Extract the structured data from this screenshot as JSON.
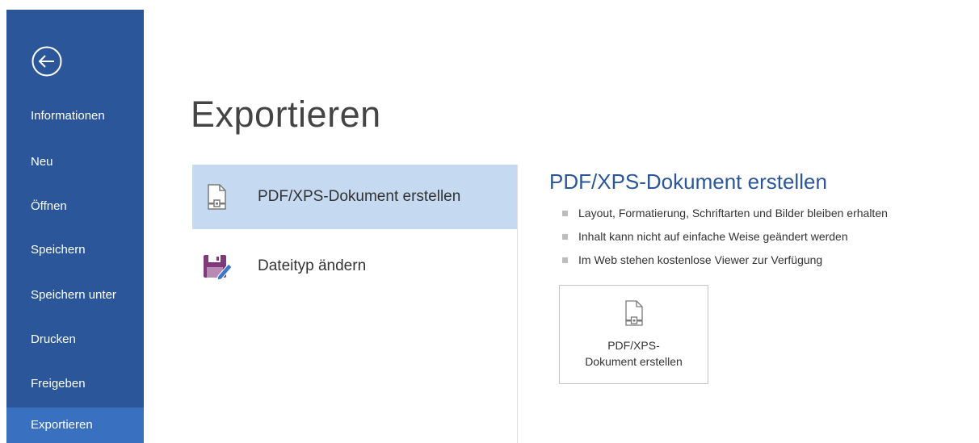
{
  "sidebar": {
    "items": [
      {
        "label": "Informationen"
      },
      {
        "label": "Neu"
      },
      {
        "label": "Öffnen"
      },
      {
        "label": "Speichern"
      },
      {
        "label": "Speichern unter"
      },
      {
        "label": "Drucken"
      },
      {
        "label": "Freigeben"
      },
      {
        "label": "Exportieren",
        "active": true
      }
    ]
  },
  "main": {
    "title": "Exportieren",
    "options": [
      {
        "label": "PDF/XPS-Dokument erstellen",
        "icon": "pdf-document-icon",
        "selected": true
      },
      {
        "label": "Dateityp ändern",
        "icon": "save-as-filetype-icon",
        "selected": false
      }
    ],
    "detail": {
      "title": "PDF/XPS-Dokument erstellen",
      "bullets": [
        "Layout, Formatierung, Schriftarten und Bilder bleiben erhalten",
        "Inhalt kann nicht auf einfache Weise geändert werden",
        "Im Web stehen kostenlose Viewer zur Verfügung"
      ],
      "button_line1": "PDF/XPS-",
      "button_line2": "Dokument erstellen"
    }
  },
  "colors": {
    "sidebar_bg": "#2b579a",
    "sidebar_active": "#3a70c0",
    "accent_title": "#2b579a",
    "selected_option": "#c5d9f1",
    "filetype_icon": "#80397b"
  }
}
